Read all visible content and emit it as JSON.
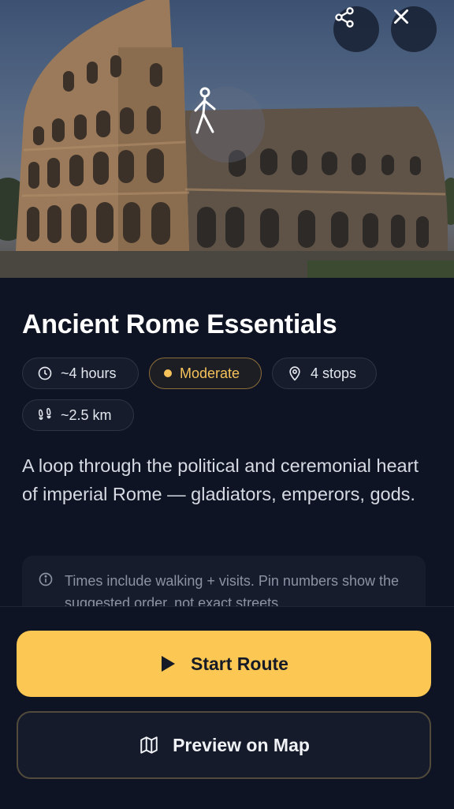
{
  "hero": {
    "image": "colosseum-photo",
    "share_icon": "share-icon",
    "close_icon": "close-icon",
    "walker_icon": "walking-person-icon"
  },
  "tour": {
    "title": "Ancient Rome Essentials",
    "duration": "~4 hours",
    "difficulty": "Moderate",
    "stops": "4 stops",
    "distance": "~2.5 km",
    "description": "A loop through the political and ceremonial heart of imperial Rome — gladiators, emperors, gods.",
    "note": "Times include walking + visits. Pin numbers show the suggested order, not exact streets."
  },
  "actions": {
    "start_label": "Start Route",
    "preview_label": "Preview on Map"
  },
  "colors": {
    "accent": "#fcc752",
    "background": "#0f1424",
    "chip_bg": "#161c2c"
  }
}
